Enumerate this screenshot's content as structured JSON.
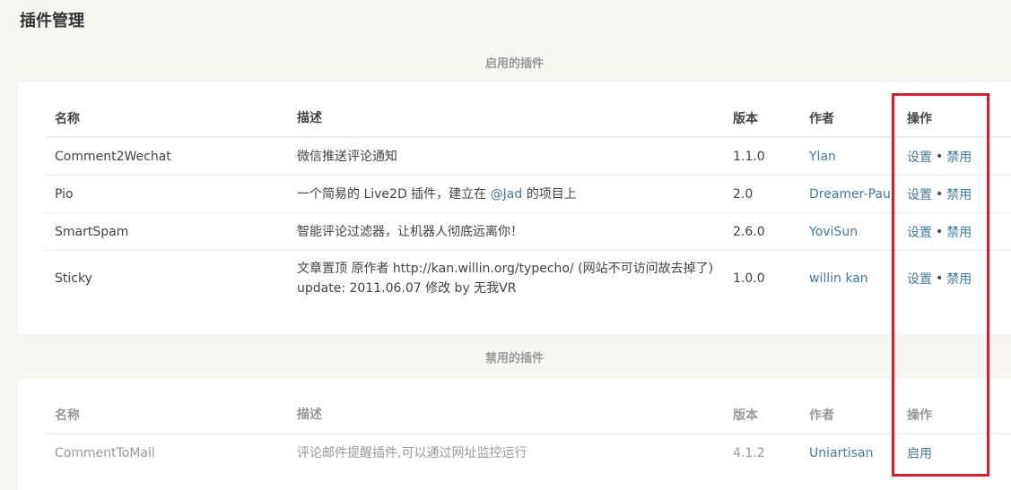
{
  "page": {
    "title": "插件管理"
  },
  "enabled": {
    "title": "启用的插件",
    "columns": {
      "name": "名称",
      "desc": "描述",
      "version": "版本",
      "author": "作者",
      "actions": "操作"
    },
    "rows": [
      {
        "name": "Comment2Wechat",
        "desc_before": "微信推送评论通知",
        "desc_link": "",
        "desc_after": "",
        "version": "1.1.0",
        "author": "Ylan",
        "action_settings": "设置",
        "action_sep": "•",
        "action_disable": "禁用"
      },
      {
        "name": "Pio",
        "desc_before": "一个简易的 Live2D 插件，建立在 ",
        "desc_link": "@Jad",
        "desc_after": " 的项目上",
        "version": "2.0",
        "author": "Dreamer-Paul",
        "action_settings": "设置",
        "action_sep": "•",
        "action_disable": "禁用"
      },
      {
        "name": "SmartSpam",
        "desc_before": "智能评论过滤器，让机器人彻底远离你！",
        "desc_link": "",
        "desc_after": "",
        "version": "2.6.0",
        "author": "YoviSun",
        "action_settings": "设置",
        "action_sep": "•",
        "action_disable": "禁用"
      },
      {
        "name": "Sticky",
        "desc_before": "文章置顶 原作者 http://kan.willin.org/typecho/ (网站不可访问故去掉了) update: 2011.06.07 修改 by 无我VR",
        "desc_link": "",
        "desc_after": "",
        "version": "1.0.0",
        "author": "willin kan",
        "action_settings": "设置",
        "action_sep": "•",
        "action_disable": "禁用"
      }
    ]
  },
  "disabled": {
    "title": "禁用的插件",
    "columns": {
      "name": "名称",
      "desc": "描述",
      "version": "版本",
      "author": "作者",
      "actions": "操作"
    },
    "rows": [
      {
        "name": "CommentToMail",
        "desc": "评论邮件提醒插件,可以通过网址监控运行",
        "version": "4.1.2",
        "author": "Uniartisan",
        "action_enable": "启用"
      }
    ]
  },
  "colors": {
    "link": "#467b96",
    "highlight": "#cc2233",
    "background": "#f6f6f3"
  }
}
